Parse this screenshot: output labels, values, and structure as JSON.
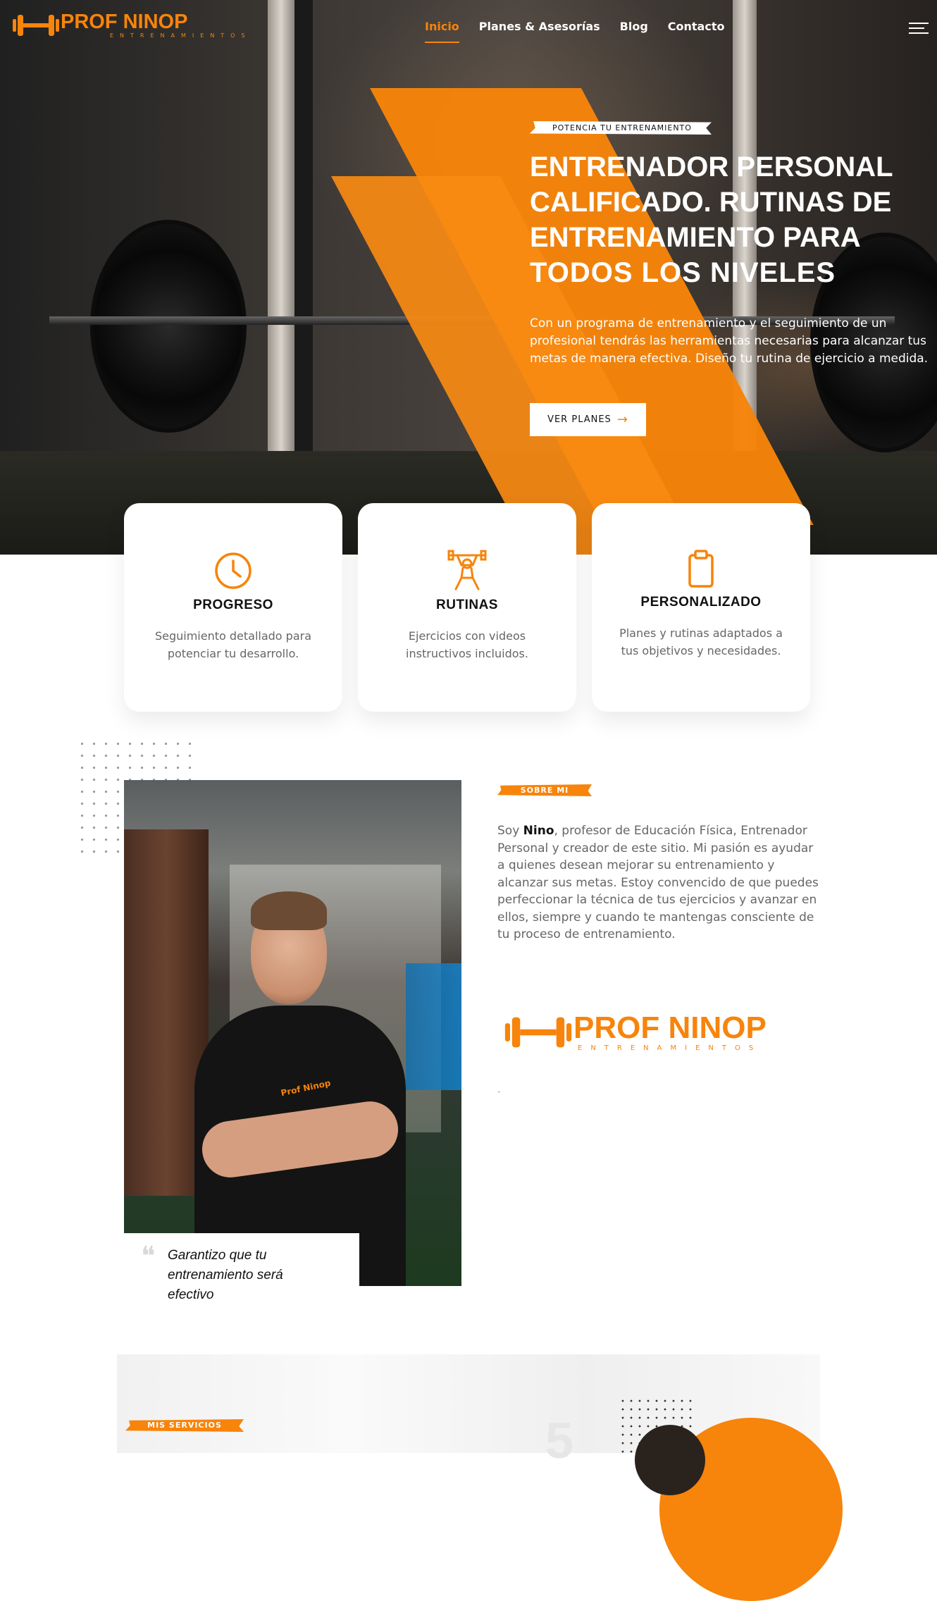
{
  "brand": {
    "name": "PROF NINOP",
    "subtitle": "ENTRENAMIENTOS",
    "accent": "#f7840b"
  },
  "nav": {
    "items": [
      {
        "label": "Inicio",
        "active": true
      },
      {
        "label": "Planes & Asesorías",
        "active": false
      },
      {
        "label": "Blog",
        "active": false
      },
      {
        "label": "Contacto",
        "active": false
      }
    ],
    "menu_icon": "hamburger-icon"
  },
  "hero": {
    "badge": "POTENCIA TU ENTRENAMIENTO",
    "title_bold": "ENTRENADOR PERSONAL CALIFICADO. RUTINAS DE ENTRENAMIENTO PARA",
    "title_light": "TODOS LOS NIVELES",
    "description": "Con un programa de entrenamiento y el seguimiento de un profesional tendrás las herramientas necesarias para alcanzar tus metas de manera efectiva. Diseño tu rutina de ejercicio a medida.",
    "cta": "VER PLANES"
  },
  "features": [
    {
      "icon": "clock-icon",
      "title": "PROGRESO",
      "text": "Seguimiento detallado para potenciar tu desarrollo."
    },
    {
      "icon": "weightlifter-icon",
      "title": "RUTINAS",
      "text": "Ejercicios con videos instructivos incluidos."
    },
    {
      "icon": "clipboard-icon",
      "title": "PERSONALIZADO",
      "text": "Planes y rutinas adaptados a tus objetivos y necesidades."
    }
  ],
  "about": {
    "tag": "SOBRE MI",
    "text_prefix": "Soy ",
    "text_name": "Nino",
    "text_rest": ", profesor de Educación Física, Entrenador Personal y creador de este sitio. Mi pasión es ayudar a quienes desean mejorar su entrenamiento y alcanzar sus metas. Estoy convencido de que puedes perfeccionar la técnica de tus ejercicios y avanzar en ellos, siempre y cuando te mantengas consciente de tu proceso de entrenamiento.",
    "quote": "Garantizo que tu entrenamiento será efectivo",
    "shirt_logo": "Prof Ninop",
    "dash": "-"
  },
  "services": {
    "tag": "MIS SERVICIOS"
  }
}
